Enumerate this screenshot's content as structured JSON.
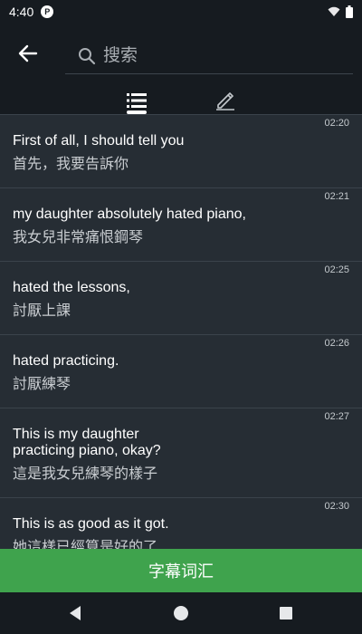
{
  "status_bar": {
    "time": "4:40",
    "app_icon_letter": "P"
  },
  "search": {
    "placeholder": "搜索"
  },
  "tabs": [
    {
      "name": "list",
      "icon": "list-icon",
      "active": true
    },
    {
      "name": "edit",
      "icon": "pencil-icon",
      "active": false
    }
  ],
  "subtitles": [
    {
      "time": "02:20",
      "en": "First of all, I should tell you",
      "zh": "首先，我要告訴你"
    },
    {
      "time": "02:21",
      "en": "my daughter absolutely hated piano,",
      "zh": "我女兒非常痛恨鋼琴"
    },
    {
      "time": "02:25",
      "en": "hated the lessons,",
      "zh": "討厭上課"
    },
    {
      "time": "02:26",
      "en": "hated practicing.",
      "zh": "討厭練琴"
    },
    {
      "time": "02:27",
      "en": "This is my daughter\npracticing piano, okay?",
      "zh": "這是我女兒練琴的樣子"
    },
    {
      "time": "02:30",
      "en": "This is as good as it got.",
      "zh": "她這樣已經算是好的了"
    }
  ],
  "vocab_button": {
    "label": "字幕词汇"
  },
  "colors": {
    "accent": "#3fa34d",
    "background": "#262d34",
    "header": "#161b20"
  }
}
